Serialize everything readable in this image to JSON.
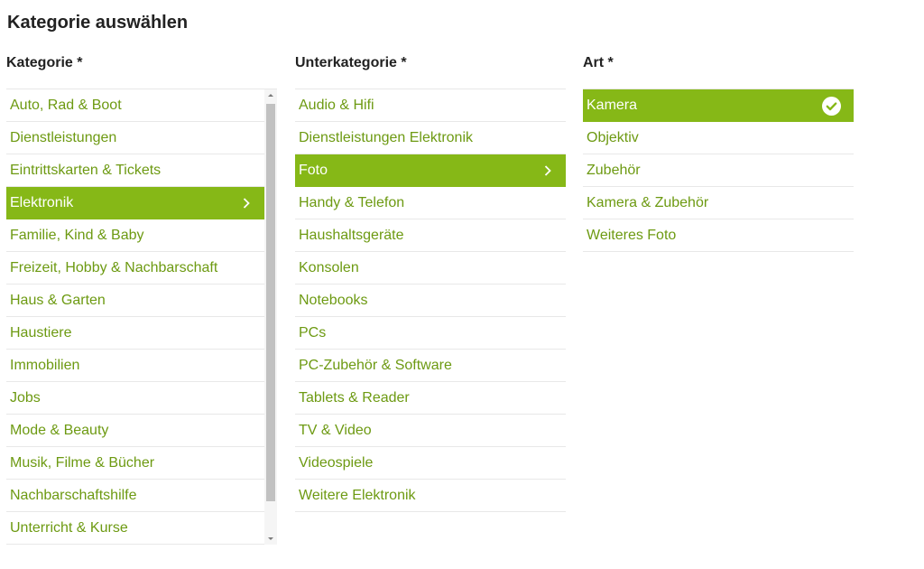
{
  "page": {
    "title": "Kategorie auswählen"
  },
  "columns": {
    "kategorie": {
      "heading": "Kategorie *",
      "items": [
        {
          "label": "Auto, Rad & Boot"
        },
        {
          "label": "Dienstleistungen"
        },
        {
          "label": "Eintrittskarten & Tickets"
        },
        {
          "label": "Elektronik",
          "selected": true
        },
        {
          "label": "Familie, Kind & Baby"
        },
        {
          "label": "Freizeit, Hobby & Nachbarschaft"
        },
        {
          "label": "Haus & Garten"
        },
        {
          "label": "Haustiere"
        },
        {
          "label": "Immobilien"
        },
        {
          "label": "Jobs"
        },
        {
          "label": "Mode & Beauty"
        },
        {
          "label": "Musik, Filme & Bücher"
        },
        {
          "label": "Nachbarschaftshilfe"
        },
        {
          "label": "Unterricht & Kurse"
        }
      ]
    },
    "unterkategorie": {
      "heading": "Unterkategorie *",
      "items": [
        {
          "label": "Audio & Hifi"
        },
        {
          "label": "Dienstleistungen Elektronik"
        },
        {
          "label": "Foto",
          "selected": true
        },
        {
          "label": "Handy & Telefon"
        },
        {
          "label": "Haushaltsgeräte"
        },
        {
          "label": "Konsolen"
        },
        {
          "label": "Notebooks"
        },
        {
          "label": "PCs"
        },
        {
          "label": "PC-Zubehör & Software"
        },
        {
          "label": "Tablets & Reader"
        },
        {
          "label": "TV & Video"
        },
        {
          "label": "Videospiele"
        },
        {
          "label": "Weitere Elektronik"
        }
      ]
    },
    "art": {
      "heading": "Art *",
      "items": [
        {
          "label": "Kamera",
          "selected": true
        },
        {
          "label": "Objektiv"
        },
        {
          "label": "Zubehör"
        },
        {
          "label": "Kamera & Zubehör"
        },
        {
          "label": "Weiteres Foto"
        }
      ]
    }
  },
  "colors": {
    "accent": "#86b817",
    "link": "#6d9a12",
    "divider": "#e8e8e8"
  },
  "icons": {
    "selected_category": "chevron-right-icon",
    "selected_type": "check-circle-icon"
  }
}
